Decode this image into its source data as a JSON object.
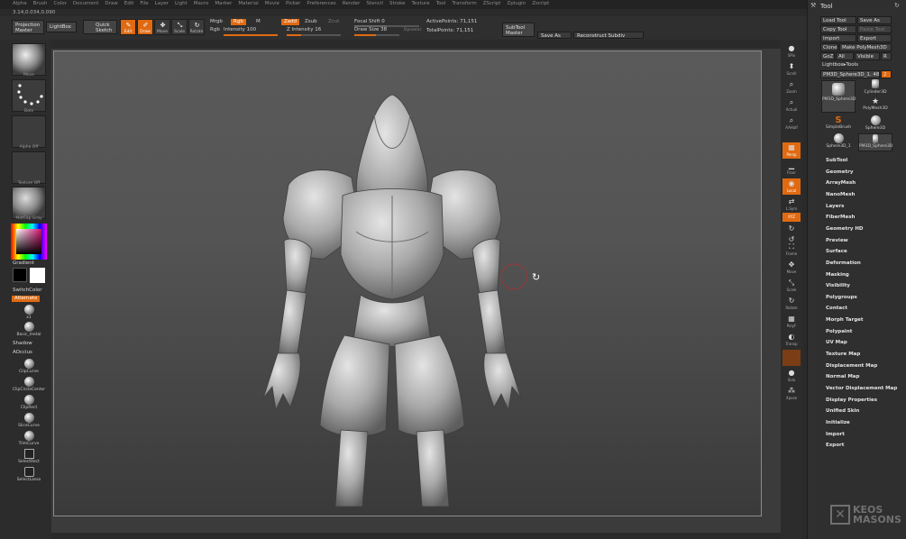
{
  "menu": [
    "Alpha",
    "Brush",
    "Color",
    "Document",
    "Draw",
    "Edit",
    "File",
    "Layer",
    "Light",
    "Macro",
    "Marker",
    "Material",
    "Movie",
    "Picker",
    "Preferences",
    "Render",
    "Stencil",
    "Stroke",
    "Texture",
    "Tool",
    "Transform",
    "ZScript",
    "Zplugin",
    "Zscript"
  ],
  "coords": "3.14,0.034,0.090",
  "toolbar": {
    "projection_master": "Projection Master",
    "lightbox": "LightBox",
    "quick_sketch": "Quick Sketch",
    "edit": "Edit",
    "draw": "Draw",
    "move": "Move",
    "scale": "Scale",
    "rotate": "Rotate",
    "mrgb": "Mrgb",
    "rgb_tag": "Rgb",
    "m": "M",
    "zadd": "Zadd",
    "zsub": "Zsub",
    "zcut": "Zcut",
    "rgb": "Rgb",
    "rgb_intensity": "Intensity 100",
    "z_intensity": "Z Intensity 16",
    "focal_shift": "Focal Shift 0",
    "draw_size": "Draw Size 38",
    "dynamic": "Dynamic",
    "active_points": "ActivePoints: 71,151",
    "total_points": "TotalPoints: 71,151",
    "subtool_master": "SubTool Master",
    "save_as": "Save As",
    "reconstruct_subdiv": "Reconstruct Subdiv"
  },
  "left": {
    "brush_label": "Move",
    "stroke_label": "Dots",
    "alpha_label": "Alpha Off",
    "texture_label": "Texture Off",
    "material_label": "MatCap Gray",
    "gradient": "Gradient",
    "switch_color": "SwitchColor",
    "alternate": "Alternate",
    "mat1": "x1",
    "mat2": "Basic_metal",
    "shadow": "Shadow",
    "aocclus": "AOcclus",
    "tools": [
      "ClipCurve",
      "ClipCircleCenter",
      "ClipRect",
      "SliceCurve",
      "TrimCurve",
      "SelectRect",
      "SelectLasso"
    ]
  },
  "right": {
    "items": [
      "SPix",
      "Scroll",
      "Zoom",
      "Actual",
      "AAHalf",
      "Persp",
      "Floor",
      "Local",
      "L.Sym",
      "XYZ",
      "",
      "",
      "Frame",
      "Move",
      "Scale",
      "Rotate",
      "PolyF",
      "Transp",
      "",
      "Solo",
      "Xpose"
    ]
  },
  "palette": {
    "title": "Tool",
    "load_tool": "Load Tool",
    "save_as": "Save As",
    "copy_tool": "Copy Tool",
    "paste_tool": "Paste Tool",
    "import": "Import",
    "export": "Export",
    "clone": "Clone",
    "make_polymesh": "Make PolyMesh3D",
    "goz": "GoZ",
    "all": "All",
    "visible": "Visible",
    "r": "R",
    "lightbox_tools": "Lightbox▸Tools",
    "current_tool": "PM3D_Sphere3D_1. 48",
    "tool_count": "2",
    "subtools": [
      "PM3D_Sphere3D",
      "Cylinder3D",
      "PolyMesh3D",
      "SimpleBrush",
      "Sphere3D",
      "Sphere3D_1",
      "PM3D_Sphere3D"
    ],
    "menu": [
      "SubTool",
      "Geometry",
      "ArrayMesh",
      "NanoMesh",
      "Layers",
      "FiberMesh",
      "Geometry HD",
      "Preview",
      "Surface",
      "Deformation",
      "Masking",
      "Visibility",
      "Polygroups",
      "Contact",
      "Morph Target",
      "Polypaint",
      "UV Map",
      "Texture Map",
      "Displacement Map",
      "Normal Map",
      "Vector Displacement Map",
      "Display Properties",
      "Unified Skin",
      "Initialize",
      "Import",
      "Export"
    ]
  },
  "watermark": "KEOS MASONS",
  "colors": {
    "accent": "#e06a12",
    "bg": "#2a2a2a",
    "canvas": "#555555"
  }
}
